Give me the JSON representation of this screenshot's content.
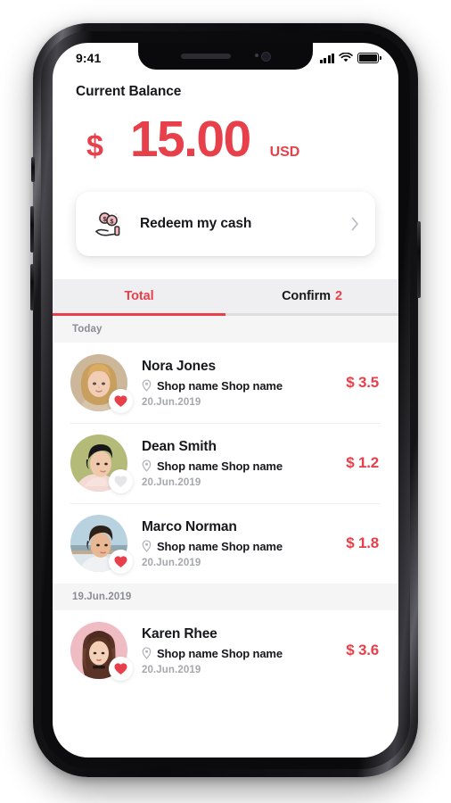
{
  "status_bar": {
    "time": "9:41",
    "signal_icon": "signal-bars-icon",
    "wifi_icon": "wifi-icon",
    "battery_icon": "battery-full-icon"
  },
  "balance": {
    "title": "Current Balance",
    "currency_symbol": "$",
    "amount": "15.00",
    "currency_code": "USD",
    "color": "#e8404a"
  },
  "redeem": {
    "label": "Redeem my cash",
    "icon": "hand-holding-coins-icon",
    "chevron": "chevron-right-icon"
  },
  "tabs": [
    {
      "label": "Total",
      "active": true,
      "count": ""
    },
    {
      "label": "Confirm",
      "active": false,
      "count": "2"
    }
  ],
  "sections": [
    {
      "header": "Today",
      "rows": [
        {
          "name": "Nora Jones",
          "shop": "Shop name Shop name",
          "date": "20.Jun.2019",
          "amount": "$ 3.5",
          "liked": true,
          "location_icon": "map-pin-icon",
          "heart_icon": "heart-filled-icon"
        },
        {
          "name": "Dean Smith",
          "shop": "Shop name Shop name",
          "date": "20.Jun.2019",
          "amount": "$ 1.2",
          "liked": false,
          "location_icon": "map-pin-icon",
          "heart_icon": "heart-outline-icon"
        },
        {
          "name": "Marco Norman",
          "shop": "Shop name Shop name",
          "date": "20.Jun.2019",
          "amount": "$ 1.8",
          "liked": true,
          "location_icon": "map-pin-icon",
          "heart_icon": "heart-filled-icon"
        }
      ]
    },
    {
      "header": "19.Jun.2019",
      "rows": [
        {
          "name": "Karen Rhee",
          "shop": "Shop name Shop name",
          "date": "20.Jun.2019",
          "amount": "$ 3.6",
          "liked": true,
          "location_icon": "map-pin-icon",
          "heart_icon": "heart-filled-icon"
        }
      ]
    }
  ]
}
